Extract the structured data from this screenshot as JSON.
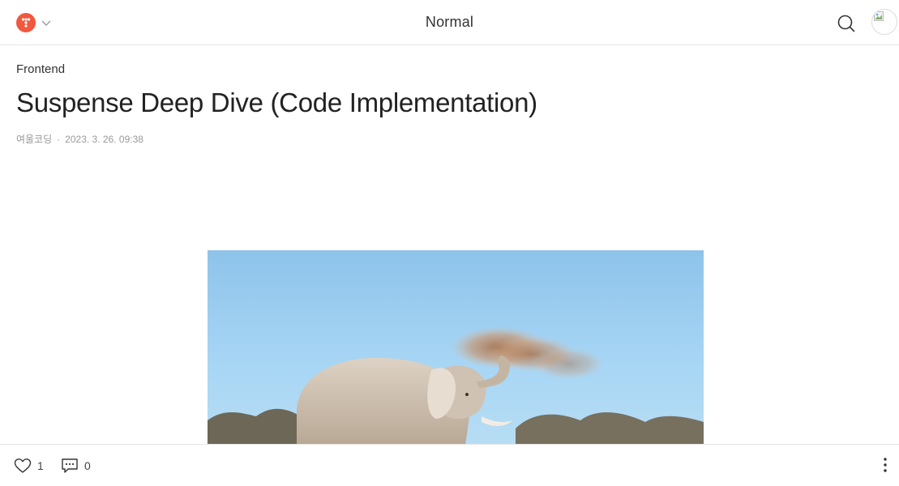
{
  "header": {
    "blog_title": "Normal"
  },
  "post": {
    "category": "Frontend",
    "title": "Suspense Deep Dive (Code Implementation)",
    "author": "여울코딩",
    "separator": "·",
    "date": "2023. 3. 26. 09:38"
  },
  "footer": {
    "like_count": "1",
    "comment_count": "0"
  },
  "icons": {
    "logo": "tistory-logo-icon",
    "caret": "chevron-down-icon",
    "search": "search-icon",
    "avatar": "profile-avatar",
    "like": "heart-icon",
    "comment": "comment-icon",
    "more": "more-vertical-icon"
  },
  "colors": {
    "brand": "#f0583f",
    "text": "#222222",
    "meta": "#999999",
    "border": "#e6e6e6"
  }
}
